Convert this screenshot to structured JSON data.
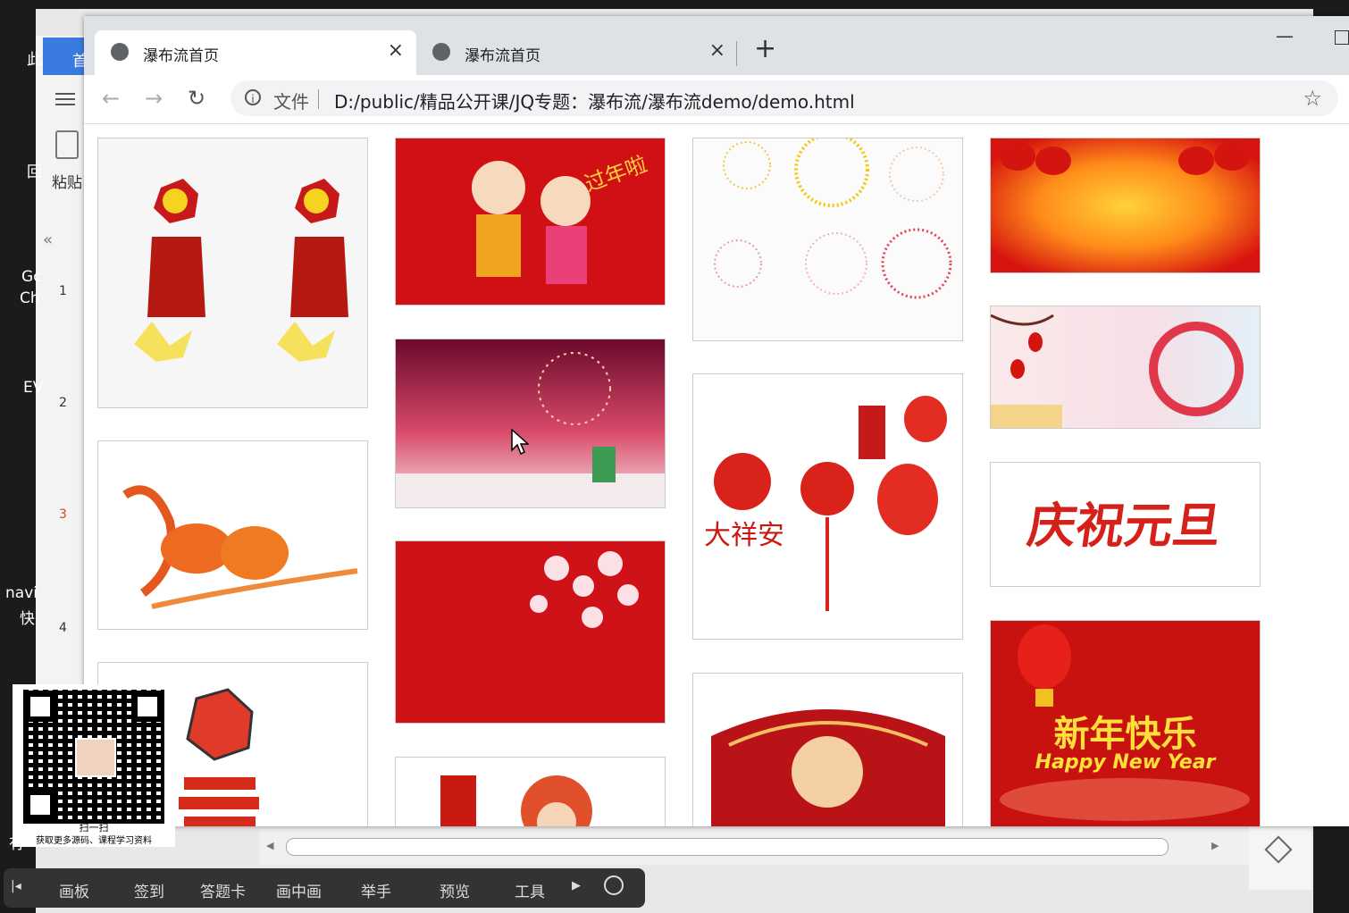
{
  "desktop": {
    "labels": [
      "此",
      "回",
      "Gc",
      "Ch",
      "EV",
      "navi",
      "快",
      "有"
    ],
    "ppt_tab_label": "首",
    "paste_label": "粘贴",
    "slide_numbers": [
      "1",
      "2",
      "3",
      "4"
    ]
  },
  "browser": {
    "tabs": [
      {
        "title": "瀑布流首页",
        "close": "×"
      },
      {
        "title": "瀑布流首页",
        "close": "×"
      }
    ],
    "new_tab": "+",
    "minimize": "—",
    "back": "←",
    "forward": "→",
    "reload": "↻",
    "info": "i",
    "file_label": "文件",
    "url": "D:/public/精品公开课/JQ专题：瀑布流/瀑布流demo/demo.html",
    "star": "☆"
  },
  "gallery": {
    "items": [
      {
        "desc": "鞭炮",
        "theme": "firecracker"
      },
      {
        "desc": "过年啦",
        "theme": "kids",
        "text": "过年啦"
      },
      {
        "desc": "烟花",
        "theme": "fireworks"
      },
      {
        "desc": "灯笼红底",
        "theme": "lanterns"
      },
      {
        "desc": "红色夜景",
        "theme": "night"
      },
      {
        "desc": "梅花圆环",
        "theme": "plum"
      },
      {
        "desc": "剪纸鱼",
        "theme": "fish"
      },
      {
        "desc": "大吉大利剪纸",
        "theme": "papercut",
        "text": "大祥安"
      },
      {
        "desc": "庆祝元旦",
        "theme": "text",
        "text": "庆祝元旦"
      },
      {
        "desc": "梅花红底",
        "theme": "blossom"
      },
      {
        "desc": "卡通鞭炮",
        "theme": "cartoon"
      },
      {
        "desc": "扇形",
        "theme": "fan"
      },
      {
        "desc": "新年快乐",
        "theme": "newyear",
        "text": "新年快乐",
        "text2": "Happy New Year"
      },
      {
        "desc": "福娃",
        "theme": "baby"
      }
    ]
  },
  "qr": {
    "scan": "扫一扫",
    "caption": "获取更多源码、课程学习资料"
  },
  "float_toolbar": {
    "items": [
      "画板",
      "签到",
      "答题卡",
      "画中画",
      "举手",
      "预览",
      "工具"
    ]
  }
}
